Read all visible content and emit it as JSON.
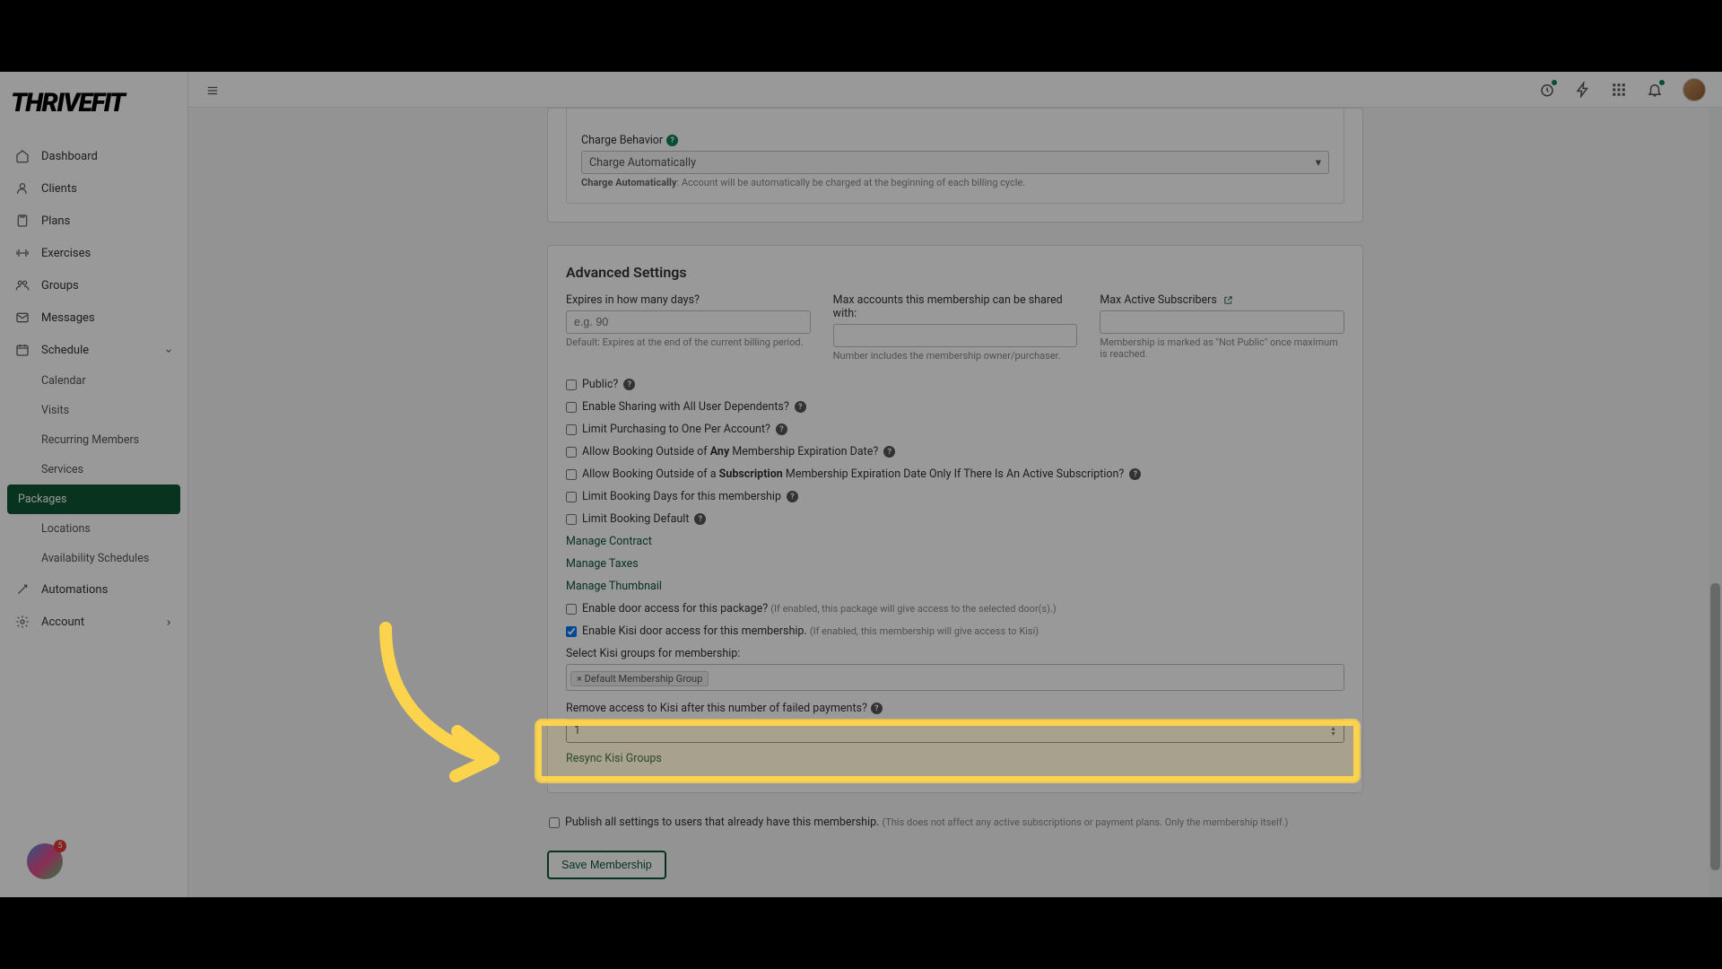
{
  "brand": "THRIVEFIT",
  "sidebar": {
    "items": [
      {
        "label": "Dashboard",
        "icon": "home"
      },
      {
        "label": "Clients",
        "icon": "user"
      },
      {
        "label": "Plans",
        "icon": "clipboard"
      },
      {
        "label": "Exercises",
        "icon": "dumbbell"
      },
      {
        "label": "Groups",
        "icon": "people"
      },
      {
        "label": "Messages",
        "icon": "mail"
      },
      {
        "label": "Schedule",
        "icon": "calendar",
        "expanded": true
      },
      {
        "label": "Automations",
        "icon": "wand"
      },
      {
        "label": "Account",
        "icon": "gear",
        "hasChevron": true
      }
    ],
    "schedule_sub": [
      {
        "label": "Calendar"
      },
      {
        "label": "Visits"
      },
      {
        "label": "Recurring Members"
      },
      {
        "label": "Services"
      },
      {
        "label": "Packages",
        "active": true
      },
      {
        "label": "Locations"
      },
      {
        "label": "Availability Schedules"
      }
    ]
  },
  "widget_count": "5",
  "charge": {
    "label": "Charge Behavior",
    "value": "Charge Automatically",
    "hint_strong": "Charge Automatically",
    "hint_rest": ": Account will be automatically be charged at the beginning of each billing cycle."
  },
  "advanced": {
    "title": "Advanced Settings",
    "expires": {
      "label": "Expires in how many days?",
      "placeholder": "e.g. 90",
      "hint": "Default: Expires at the end of the current billing period."
    },
    "max_accounts": {
      "label": "Max accounts this membership can be shared with:",
      "hint": "Number includes the membership owner/purchaser."
    },
    "max_subscribers": {
      "label": "Max Active Subscribers",
      "hint": "Membership is marked as \"Not Public\" once maximum is reached."
    },
    "checks": {
      "public": "Public?",
      "sharing": "Enable Sharing with All User Dependents?",
      "limit_one": "Limit Purchasing to One Per Account?",
      "allow_any_pre": "Allow Booking Outside of ",
      "allow_any_bold": "Any",
      "allow_any_post": " Membership Expiration Date?",
      "allow_sub_pre": "Allow Booking Outside of a ",
      "allow_sub_bold": "Subscription",
      "allow_sub_post": " Membership Expiration Date Only If There Is An Active Subscription?",
      "limit_days": "Limit Booking Days for this membership",
      "limit_default": "Limit Booking Default"
    },
    "links": {
      "contract": "Manage Contract",
      "taxes": "Manage Taxes",
      "thumbnail": "Manage Thumbnail"
    },
    "door": {
      "label": "Enable door access for this package?",
      "note": "(If enabled, this package will give access to the selected door(s).)"
    },
    "kisi": {
      "label": "Enable Kisi door access for this membership.",
      "note": "(If enabled, this membership will give access to Kisi)",
      "groups_label": "Select Kisi groups for membership:",
      "tag": "× Default Membership Group",
      "remove_label": "Remove access to Kisi after this number of failed payments?",
      "remove_value": "1",
      "resync": "Resync Kisi Groups"
    }
  },
  "publish": {
    "label": "Publish all settings to users that already have this membership.",
    "note": "(This does not affect any active subscriptions or payment plans. Only the membership itself.)"
  },
  "save_label": "Save Membership"
}
